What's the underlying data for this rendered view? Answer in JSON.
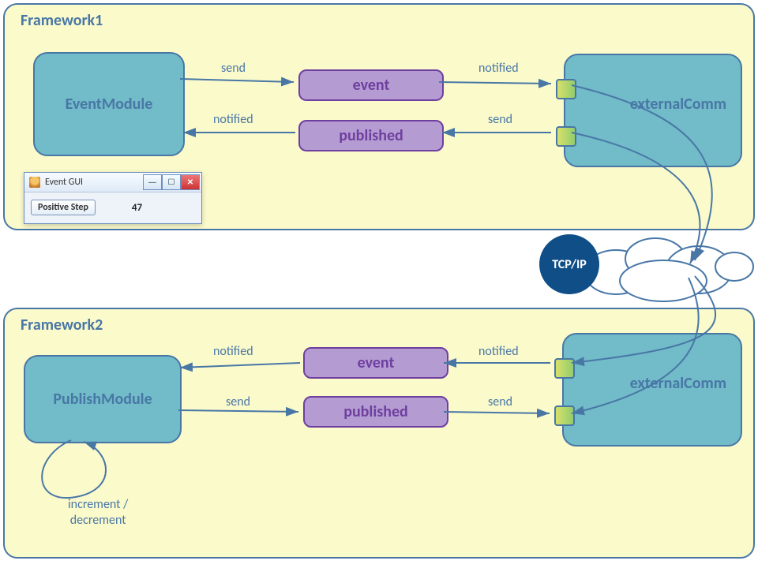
{
  "framework1": {
    "label": "Framework1",
    "module": {
      "name": "EventModule"
    },
    "messages": {
      "event": "event",
      "published": "published"
    },
    "edges": {
      "module_to_event": "send",
      "event_to_ext": "notified",
      "published_to_module": "notified",
      "ext_to_published": "send"
    },
    "ext_label": "externalComm"
  },
  "framework2": {
    "label": "Framework2",
    "module": {
      "name": "PublishModule"
    },
    "messages": {
      "event": "event",
      "published": "published"
    },
    "edges": {
      "ext_to_event": "notified",
      "event_to_module": "notified",
      "module_to_published": "send",
      "published_to_ext": "send"
    },
    "ext_label": "externalComm",
    "self_loop": "increment /\ndecrement"
  },
  "gui": {
    "title": "Event GUI",
    "button": "Positive Step",
    "value": "47"
  },
  "network": {
    "label": "TCP/IP"
  }
}
